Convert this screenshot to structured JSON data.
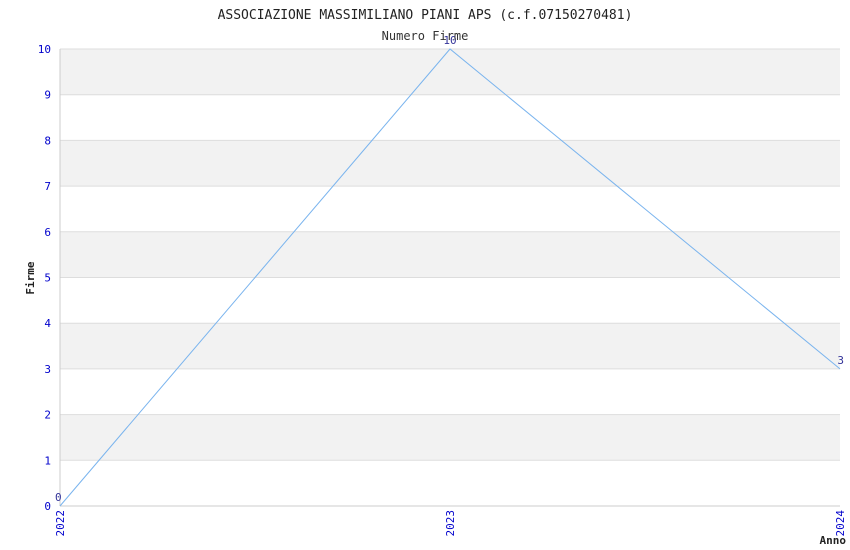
{
  "chart_data": {
    "type": "line",
    "title": "ASSOCIAZIONE MASSIMILIANO PIANI APS (c.f.07150270481)",
    "subtitle": "Numero Firme",
    "xlabel": "Anno",
    "ylabel": "Firme",
    "categories": [
      "2022",
      "2023",
      "2024"
    ],
    "series": [
      {
        "values": [
          0,
          10,
          3
        ]
      }
    ],
    "data_labels": [
      "0",
      "10",
      "3"
    ],
    "ylim": [
      0,
      10
    ],
    "yticks": [
      0,
      1,
      2,
      3,
      4,
      5,
      6,
      7,
      8,
      9,
      10
    ],
    "grid": "horizontal alternating bands",
    "legend": "none",
    "colors": {
      "line": "#7ab4ee",
      "tick_text": "#0000cc",
      "band": "#f2f2f2",
      "grid": "#dddddd",
      "axis": "#cccccc"
    }
  }
}
